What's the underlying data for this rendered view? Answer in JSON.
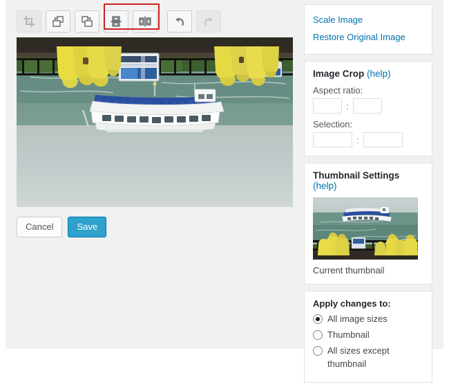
{
  "toolbar": {
    "buttons": [
      {
        "name": "crop-icon",
        "label": "Crop",
        "state": "disabled"
      },
      {
        "name": "rotate-counterclockwise-icon",
        "label": "Rotate counter-clockwise",
        "state": "enabled"
      },
      {
        "name": "rotate-clockwise-icon",
        "label": "Rotate clockwise",
        "state": "enabled"
      },
      {
        "name": "flip-vertical-icon",
        "label": "Flip vertically",
        "state": "focused"
      },
      {
        "name": "flip-horizontal-icon",
        "label": "Flip horizontally",
        "state": "focused"
      },
      {
        "name": "undo-icon",
        "label": "Undo",
        "state": "enabled"
      },
      {
        "name": "redo-icon",
        "label": "Redo",
        "state": "disabled"
      }
    ],
    "focus_color": "#cc2222"
  },
  "editor": {
    "cancel_label": "Cancel",
    "save_label": "Save",
    "image_alt": "Maid of the Mist tour boat on the Niagara river, flipped vertically"
  },
  "sidebar": {
    "scale_image_label": "Scale Image",
    "restore_original_label": "Restore Original Image",
    "crop": {
      "title": "Image Crop",
      "help_label": "(help)",
      "aspect_ratio_label": "Aspect ratio:",
      "aspect_ratio_width": "",
      "aspect_ratio_height": "",
      "selection_label": "Selection:",
      "selection_width": "",
      "selection_height": "",
      "separator": ":"
    },
    "thumbnail": {
      "title": "Thumbnail Settings",
      "help_label": "(help)",
      "caption": "Current thumbnail",
      "image_alt": "Maid of the Mist tour boat on the Niagara river"
    },
    "apply": {
      "title": "Apply changes to:",
      "options": [
        {
          "label": "All image sizes",
          "selected": true
        },
        {
          "label": "Thumbnail",
          "selected": false
        },
        {
          "label": "All sizes except thumbnail",
          "selected": false
        }
      ]
    }
  },
  "colors": {
    "link": "#0073aa",
    "primary_button": "#2ea2cc",
    "page_background": "#f1f1f1",
    "panel_background": "#ffffff"
  }
}
